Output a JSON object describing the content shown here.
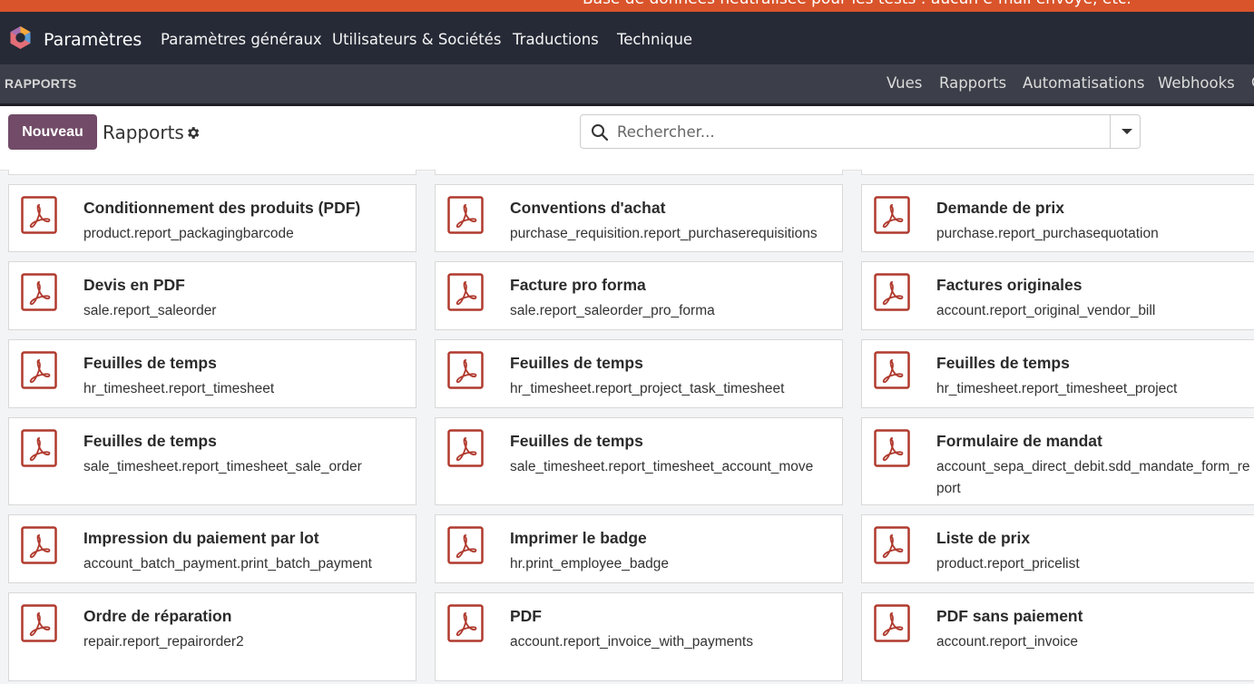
{
  "banner": {
    "text": "Base de données neutralisée pour les tests : aucun e-mail envoyé, etc."
  },
  "topnav": {
    "app_title": "Paramètres",
    "menu": [
      "Paramètres généraux",
      "Utilisateurs & Sociétés",
      "Traductions",
      "Technique"
    ]
  },
  "subnav": {
    "section": "RAPPORTS",
    "items": [
      "Vues",
      "Rapports",
      "Automatisations",
      "Webhooks"
    ],
    "overflow": "C"
  },
  "controls": {
    "new_button": "Nouveau",
    "breadcrumb": "Rapports",
    "search_placeholder": "Rechercher..."
  },
  "colors": {
    "banner": "#d9542b",
    "topnav": "#262a36",
    "subnav": "#3c3f49",
    "primary": "#714b67",
    "pdf_red": "#b03a2e"
  },
  "reports": [
    {
      "title": "Conditionnement des produits (PDF)",
      "model": "product.report_packagingbarcode",
      "icon": "pdf-icon"
    },
    {
      "title": "Conventions d'achat",
      "model": "purchase_requisition.report_purchaserequisitions",
      "icon": "pdf-icon"
    },
    {
      "title": "Demande de prix",
      "model": "purchase.report_purchasequotation",
      "icon": "pdf-icon"
    },
    {
      "title": "Devis en PDF",
      "model": "sale.report_saleorder",
      "icon": "pdf-icon"
    },
    {
      "title": "Facture pro forma",
      "model": "sale.report_saleorder_pro_forma",
      "icon": "pdf-icon"
    },
    {
      "title": "Factures originales",
      "model": "account.report_original_vendor_bill",
      "icon": "pdf-icon"
    },
    {
      "title": "Feuilles de temps",
      "model": "hr_timesheet.report_timesheet",
      "icon": "pdf-icon"
    },
    {
      "title": "Feuilles de temps",
      "model": "hr_timesheet.report_project_task_timesheet",
      "icon": "pdf-icon"
    },
    {
      "title": "Feuilles de temps",
      "model": "hr_timesheet.report_timesheet_project",
      "icon": "pdf-icon"
    },
    {
      "title": "Feuilles de temps",
      "model": "sale_timesheet.report_timesheet_sale_order",
      "icon": "pdf-icon"
    },
    {
      "title": "Feuilles de temps",
      "model": "sale_timesheet.report_timesheet_account_move",
      "icon": "pdf-icon"
    },
    {
      "title": "Formulaire de mandat",
      "model": "account_sepa_direct_debit.sdd_mandate_form_report",
      "icon": "pdf-icon"
    },
    {
      "title": "Impression du paiement par lot",
      "model": "account_batch_payment.print_batch_payment",
      "icon": "pdf-icon"
    },
    {
      "title": "Imprimer le badge",
      "model": "hr.print_employee_badge",
      "icon": "pdf-icon"
    },
    {
      "title": "Liste de prix",
      "model": "product.report_pricelist",
      "icon": "pdf-icon"
    },
    {
      "title": "Ordre de réparation",
      "model": "repair.report_repairorder2",
      "icon": "pdf-icon"
    },
    {
      "title": "PDF",
      "model": "account.report_invoice_with_payments",
      "icon": "pdf-icon"
    },
    {
      "title": "PDF sans paiement",
      "model": "account.report_invoice",
      "icon": "pdf-icon"
    }
  ]
}
